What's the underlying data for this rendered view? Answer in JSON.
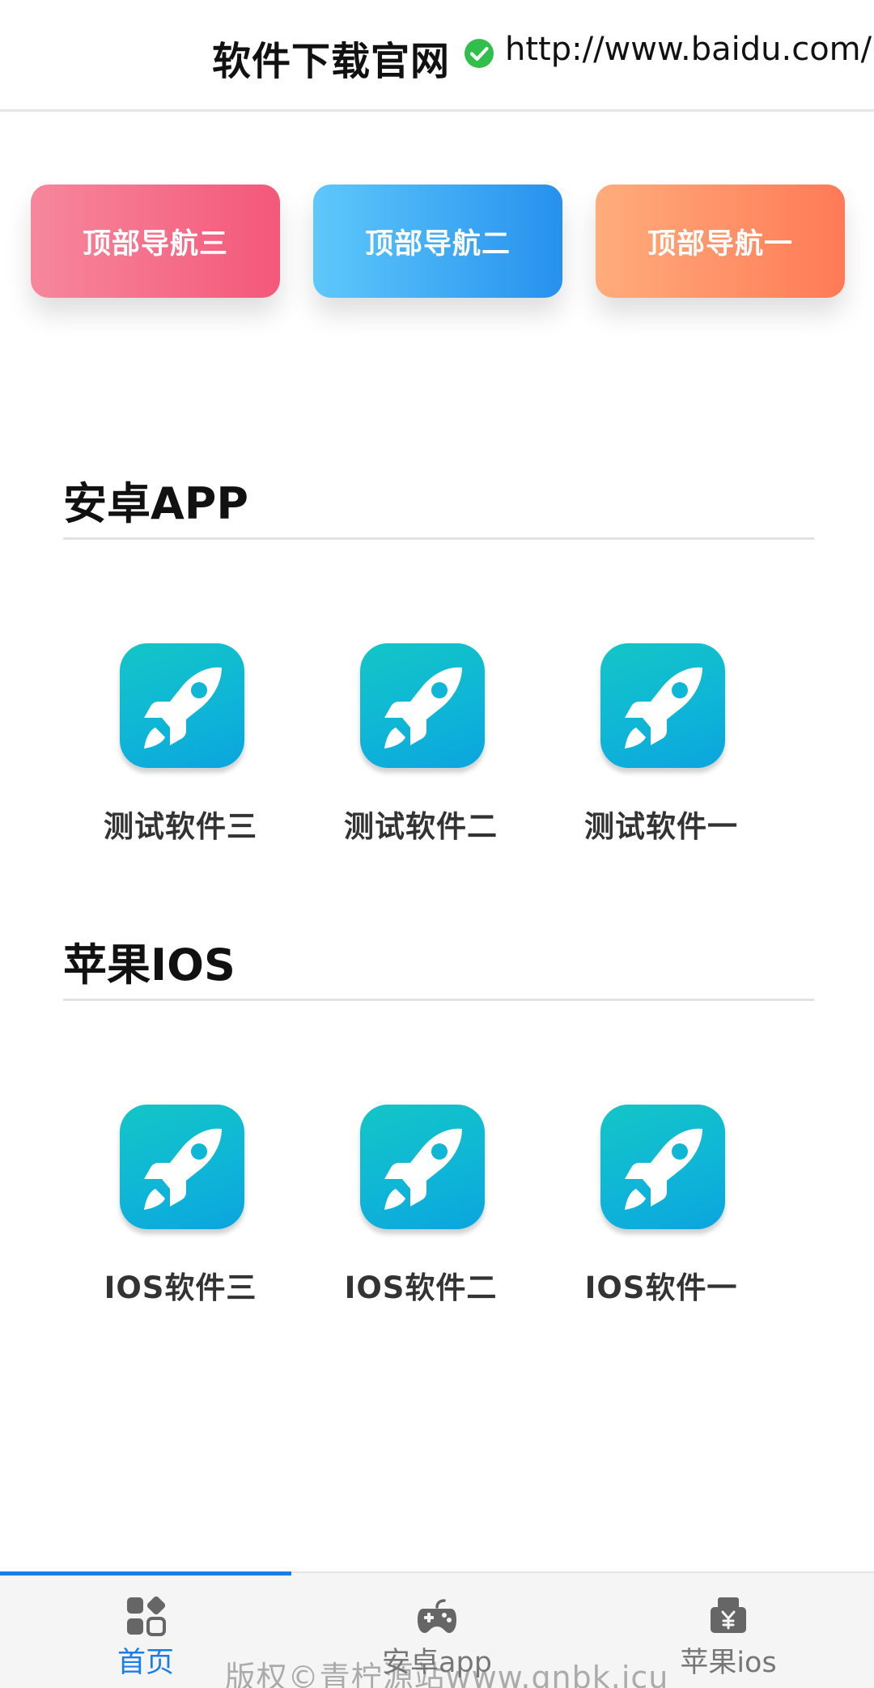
{
  "header": {
    "title": "软件下载官网",
    "url": "http://www.baidu.com/",
    "verified_icon": "check-circle-icon"
  },
  "top_nav": [
    {
      "label": "顶部导航三",
      "color_from": "#f6879c",
      "color_to": "#f4587a"
    },
    {
      "label": "顶部导航二",
      "color_from": "#5ec8fb",
      "color_to": "#2691ee"
    },
    {
      "label": "顶部导航一",
      "color_from": "#ffac7b",
      "color_to": "#ff7a57"
    }
  ],
  "sections": [
    {
      "title": "安卓APP",
      "apps": [
        {
          "label": "测试软件三",
          "icon": "rocket-icon"
        },
        {
          "label": "测试软件二",
          "icon": "rocket-icon"
        },
        {
          "label": "测试软件一",
          "icon": "rocket-icon"
        }
      ]
    },
    {
      "title": "苹果IOS",
      "apps": [
        {
          "label": "IOS软件三",
          "icon": "rocket-icon"
        },
        {
          "label": "IOS软件二",
          "icon": "rocket-icon"
        },
        {
          "label": "IOS软件一",
          "icon": "rocket-icon"
        }
      ]
    }
  ],
  "tabbar": {
    "tabs": [
      {
        "label": "首页",
        "icon": "grid-icon",
        "active": true
      },
      {
        "label": "安卓app",
        "icon": "gamepad-icon",
        "active": false
      },
      {
        "label": "苹果ios",
        "icon": "yen-printer-icon",
        "active": false
      }
    ]
  },
  "watermark": "版权©青柠源站www.qnbk.icu",
  "colors": {
    "accent": "#1a7ee8",
    "verified_green": "#2fbf4a",
    "icon_teal": "#12c6c6",
    "icon_blue": "#0aa5de"
  }
}
